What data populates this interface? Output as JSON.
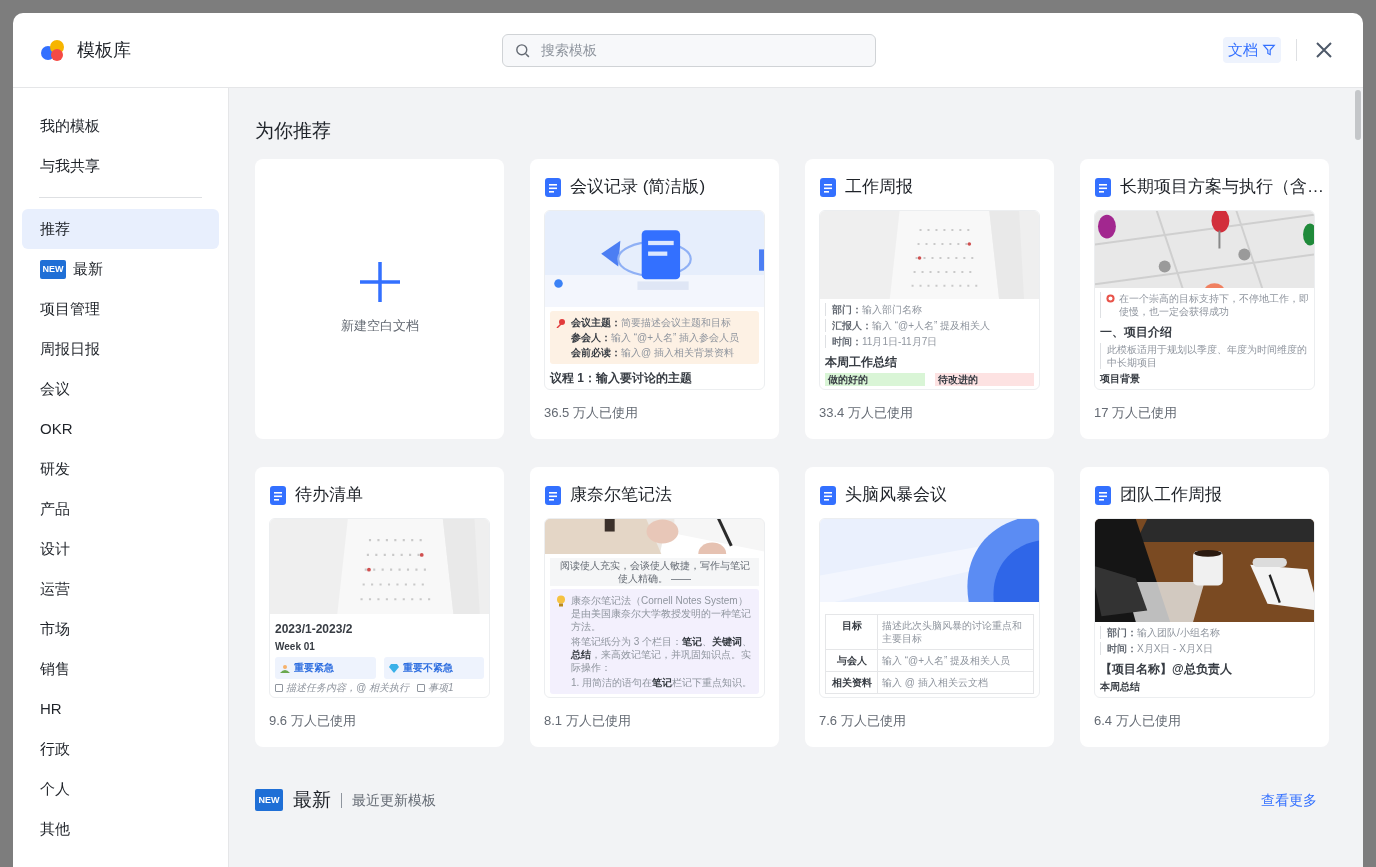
{
  "header": {
    "title": "模板库",
    "search": {
      "placeholder": "搜索模板"
    },
    "filter": {
      "label": "文档"
    }
  },
  "sidebar": {
    "personal": [
      {
        "label": "我的模板",
        "selected": false
      },
      {
        "label": "与我共享",
        "selected": false
      }
    ],
    "categories": [
      {
        "label": "推荐",
        "selected": true
      },
      {
        "label": "最新",
        "badge": "NEW",
        "selected": false
      },
      {
        "label": "项目管理",
        "selected": false
      },
      {
        "label": "周报日报",
        "selected": false
      },
      {
        "label": "会议",
        "selected": false
      },
      {
        "label": "OKR",
        "selected": false
      },
      {
        "label": "研发",
        "selected": false
      },
      {
        "label": "产品",
        "selected": false
      },
      {
        "label": "设计",
        "selected": false
      },
      {
        "label": "运营",
        "selected": false
      },
      {
        "label": "市场",
        "selected": false
      },
      {
        "label": "销售",
        "selected": false
      },
      {
        "label": "HR",
        "selected": false
      },
      {
        "label": "行政",
        "selected": false
      },
      {
        "label": "个人",
        "selected": false
      },
      {
        "label": "其他",
        "selected": false
      }
    ]
  },
  "recommended": {
    "title": "为你推荐",
    "new_doc": {
      "label": "新建空白文档"
    },
    "templates": [
      {
        "title": "会议记录 (简洁版)",
        "usage": "36.5 万人已使用",
        "preview": [
          {
            "kind": "callout",
            "color": "#fdf1e4",
            "lines": [
              "**会议主题：**简要描述会议主题和目标",
              "**参会人：**输入 “@+人名” 插入参会人员",
              "**会前必读：**输入@ 插入相关背景资料"
            ]
          },
          {
            "kind": "heading",
            "text": "议程 1：输入要讨论的主题"
          }
        ]
      },
      {
        "title": "工作周报",
        "usage": "33.4 万人已使用",
        "preview": [
          {
            "kind": "field",
            "text": "**部门：**输入部门名称"
          },
          {
            "kind": "field",
            "text": "**汇报人：**输入 “@+人名” 提及相关人"
          },
          {
            "kind": "field",
            "text": "**时间：**11月1日-11月7日"
          },
          {
            "kind": "heading",
            "text": "本周工作总结"
          },
          {
            "kind": "tags",
            "items": [
              {
                "label": "做的好的",
                "color": "#d9f5d6"
              },
              {
                "label": "待改进的",
                "color": "#fde2e2"
              }
            ]
          }
        ]
      },
      {
        "title": "长期项目方案与执行（含…",
        "usage": "17 万人已使用",
        "preview": [
          {
            "kind": "alert",
            "text": "在一个崇高的目标支持下，不停地工作，即使慢，也一定会获得成功"
          },
          {
            "kind": "heading",
            "text": "一、项目介绍"
          },
          {
            "kind": "quote",
            "text": "此模板适用于规划以季度、年度为时间维度的中长期项目"
          },
          {
            "kind": "subheading",
            "text": "项目背景"
          }
        ]
      },
      {
        "title": "待办清单",
        "usage": "9.6 万人已使用",
        "preview": [
          {
            "kind": "heading",
            "text": "2023/1-2023/2"
          },
          {
            "kind": "subheading",
            "text": "Week 01"
          },
          {
            "kind": "boxes",
            "items": [
              {
                "label": "重要紧急"
              },
              {
                "label": "重要不紧急"
              }
            ]
          },
          {
            "kind": "checks",
            "items": [
              {
                "label": "描述任务内容，@ 相关执行",
                "checked": false
              },
              {
                "label": "事项1",
                "checked": false
              }
            ]
          }
        ]
      },
      {
        "title": "康奈尔笔记法",
        "usage": "8.1 万人已使用",
        "preview": [
          {
            "kind": "banner",
            "text": "阅读使人充实，会谈使人敏捷，写作与笔记使人精确。 ——"
          },
          {
            "kind": "callout",
            "color": "#f3f0fd",
            "lines": [
              "康奈尔笔记法（Cornell Notes System）是由美国康奈尔大学教授发明的一种笔记方法。",
              "将笔记纸分为 3 个栏目：**笔记**、**关键词**、**总结**，来高效记笔记，并巩固知识点。实际操作：",
              "1. 用简洁的语句在**笔记**栏记下重点知识。"
            ]
          }
        ]
      },
      {
        "title": "头脑风暴会议",
        "usage": "7.6 万人已使用",
        "preview": [
          {
            "kind": "table",
            "rows": [
              [
                "目标",
                "描述此次头脑风暴的讨论重点和主要目标"
              ],
              [
                "与会人",
                "输入 “@+人名” 提及相关人员"
              ],
              [
                "相关资料",
                "输入 @ 插入相关云文档"
              ]
            ]
          }
        ]
      },
      {
        "title": "团队工作周报",
        "usage": "6.4 万人已使用",
        "preview": [
          {
            "kind": "field",
            "text": "**部门：**输入团队/小组名称"
          },
          {
            "kind": "field",
            "text": "**时间：**X月X日 - X月X日"
          },
          {
            "kind": "heading",
            "text": "【项目名称】@总负责人"
          },
          {
            "kind": "subheading",
            "text": "本周总结"
          }
        ]
      }
    ]
  },
  "latest": {
    "badge": "NEW",
    "title": "最新",
    "subtitle": "最近更新模板",
    "more_link": "查看更多"
  }
}
